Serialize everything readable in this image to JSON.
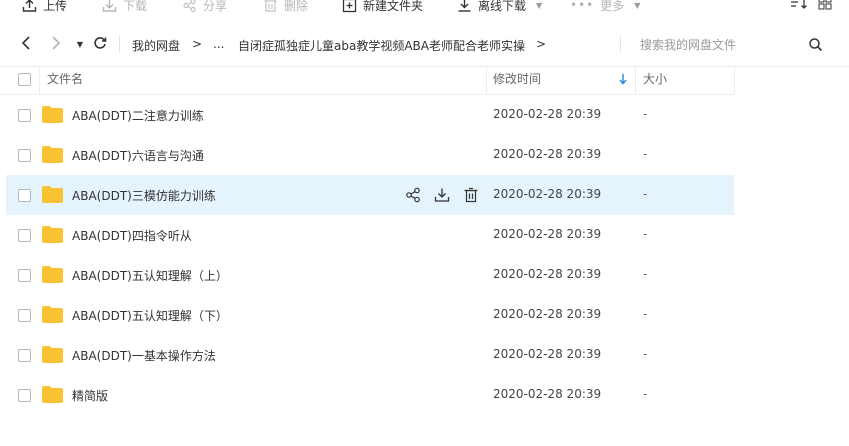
{
  "toolbar": {
    "upload": "上传",
    "download": "下载",
    "share": "分享",
    "delete": "删除",
    "new_folder": "新建文件夹",
    "offline_download": "离线下载",
    "more": "更多"
  },
  "nav": {
    "breadcrumb_root": "我的网盘",
    "breadcrumb_sep": ">",
    "breadcrumb_ellipsis": "...",
    "breadcrumb_current": "自闭症孤独症儿童aba教学视频ABA老师配合老师实操",
    "search_placeholder": "搜索我的网盘文件"
  },
  "table": {
    "col_name": "文件名",
    "col_modified": "修改时间",
    "col_size": "大小",
    "rows": [
      {
        "name": "ABA(DDT)二注意力训练",
        "modified": "2020-02-28 20:39",
        "size": "-"
      },
      {
        "name": "ABA(DDT)六语言与沟通",
        "modified": "2020-02-28 20:39",
        "size": "-"
      },
      {
        "name": "ABA(DDT)三模仿能力训练",
        "modified": "2020-02-28 20:39",
        "size": "-"
      },
      {
        "name": "ABA(DDT)四指令听从",
        "modified": "2020-02-28 20:39",
        "size": "-"
      },
      {
        "name": "ABA(DDT)五认知理解（上）",
        "modified": "2020-02-28 20:39",
        "size": "-"
      },
      {
        "name": "ABA(DDT)五认知理解（下）",
        "modified": "2020-02-28 20:39",
        "size": "-"
      },
      {
        "name": "ABA(DDT)一基本操作方法",
        "modified": "2020-02-28 20:39",
        "size": "-"
      },
      {
        "name": "精简版",
        "modified": "2020-02-28 20:39",
        "size": "-"
      }
    ]
  },
  "colors": {
    "folder": "#f8c233",
    "hover_row": "#e5f3fc",
    "sort_arrow": "#2b8cdd"
  }
}
